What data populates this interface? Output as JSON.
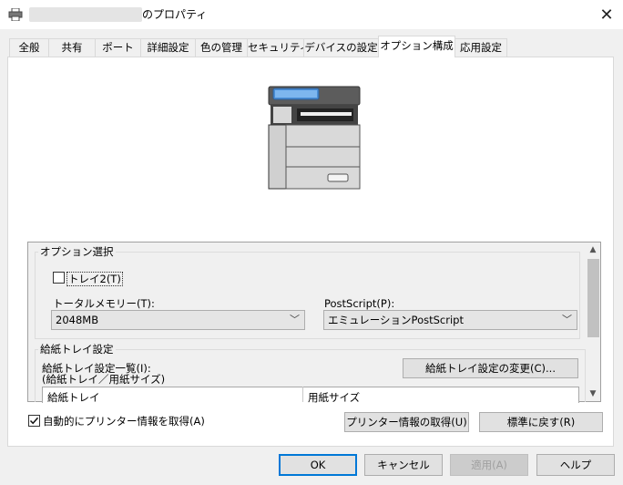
{
  "window": {
    "title_suffix": "のプロパティ",
    "close_glyph": "✕"
  },
  "tabs": [
    {
      "label": "全般"
    },
    {
      "label": "共有"
    },
    {
      "label": "ポート"
    },
    {
      "label": "詳細設定"
    },
    {
      "label": "色の管理"
    },
    {
      "label": "セキュリティ"
    },
    {
      "label": "デバイスの設定"
    },
    {
      "label": "オプション構成",
      "active": true
    },
    {
      "label": "応用設定"
    }
  ],
  "options": {
    "group_label": "オプション選択",
    "tray2_label": "トレイ2(T)",
    "tray2_checked": false,
    "memory_label": "トータルメモリー(T):",
    "memory_value": "2048MB",
    "postscript_label": "PostScript(P):",
    "postscript_value": "エミュレーションPostScript"
  },
  "paper_tray": {
    "group_label": "給紙トレイ設定",
    "list_label_1": "給紙トレイ設定一覧(I):",
    "list_label_2": "(給紙トレイ／用紙サイズ)",
    "change_button": "給紙トレイ設定の変更(C)...",
    "columns": [
      "給紙トレイ",
      "用紙サイズ"
    ]
  },
  "bottom": {
    "auto_fetch_label": "自動的にプリンター情報を取得(A)",
    "auto_fetch_checked": true,
    "fetch_button": "プリンター情報の取得(U)",
    "reset_button": "標準に戻す(R)"
  },
  "dialog_buttons": {
    "ok": "OK",
    "cancel": "キャンセル",
    "apply": "適用(A)",
    "help": "ヘルプ"
  },
  "icons": [
    "printer-icon",
    "close-icon",
    "multifunction-printer-icon",
    "scroll-up-icon",
    "scroll-down-icon",
    "chevron-down-icon",
    "checkmark-icon"
  ]
}
